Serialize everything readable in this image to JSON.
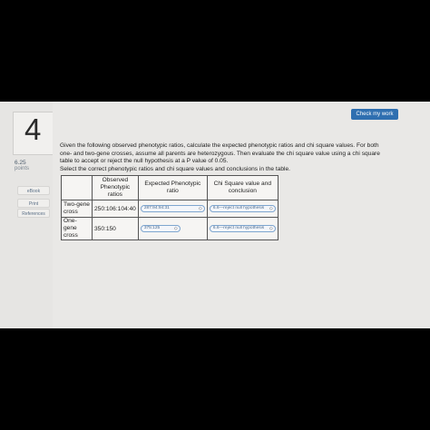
{
  "header": {
    "check_label": "Check my work"
  },
  "question": {
    "number": "4",
    "points_value": "6.25",
    "points_label": "points",
    "text_line1": "Given the following observed phenotypic ratios, calculate the expected phenotypic ratios and chi square values. For both",
    "text_line2": "one- and two-gene crosses, assume all parents are heterozygous. Then evaluate the chi square value using a chi square",
    "text_line3": "table to accept or reject the null hypothesis at a P value of 0.05.",
    "text_line4": "Select the correct phenotypic ratios and chi square values and conclusions in the table."
  },
  "sidebar": {
    "ebook": "eBook",
    "print": "Print",
    "references": "References"
  },
  "table": {
    "headers": [
      "",
      "Observed Phenotypic ratios",
      "Expected Phenotypic ratio",
      "Chi Square value and conclusion"
    ],
    "rows": [
      {
        "label": "Two-gene cross",
        "observed": "250:106:104:40",
        "expected": "287:94:94:31",
        "conclusion": "6.6—reject null hypothesis"
      },
      {
        "label": "One-gene cross",
        "observed": "350:150",
        "expected": "375:125",
        "conclusion": "6.6—reject null hypothesis"
      }
    ]
  },
  "icons": {
    "dropdown": "chevron-down-icon"
  }
}
